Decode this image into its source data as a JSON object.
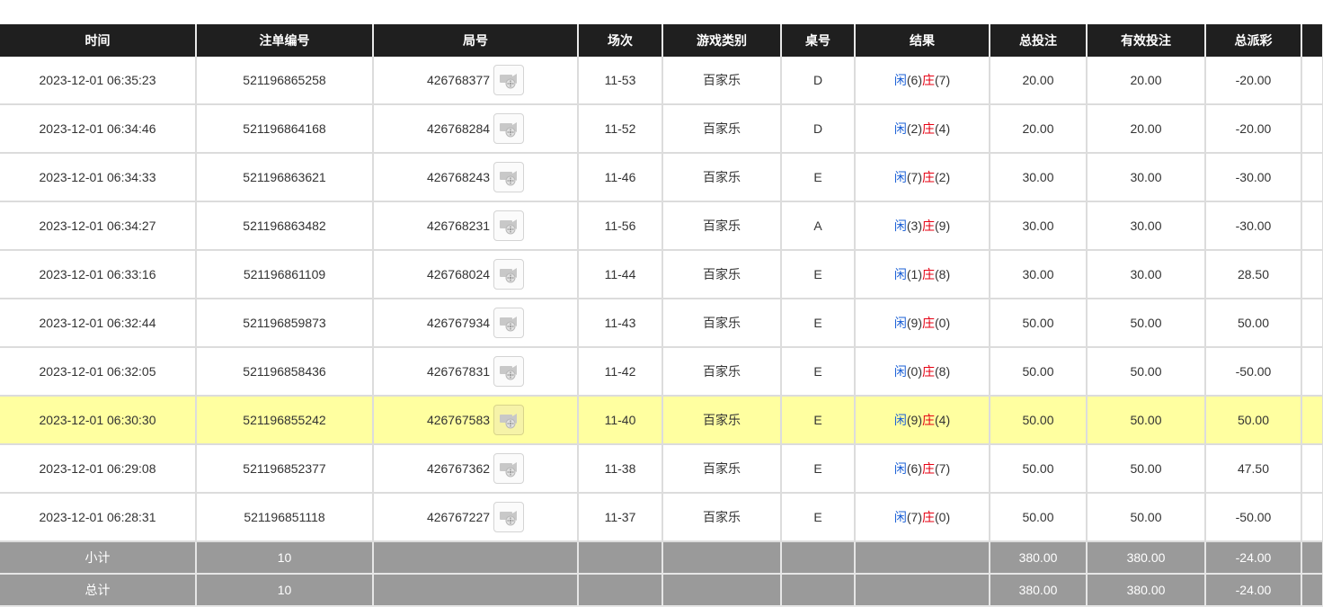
{
  "headers": [
    "时间",
    "注单编号",
    "局号",
    "场次",
    "游戏类别",
    "桌号",
    "结果",
    "总投注",
    "有效投注",
    "总派彩"
  ],
  "colors": {
    "blue": "#1a5fd6",
    "red": "#e60012",
    "highlight": "#ffffa0",
    "header_bg": "#1f1f1f",
    "summary_bg": "#9a9a9a"
  },
  "rows": [
    {
      "time": "2023-12-01 06:35:23",
      "bet_id": "521196865258",
      "round": "426768377",
      "game_no": "11-53",
      "game": "百家乐",
      "table": "D",
      "p_label": "闲",
      "p_val": "(6)",
      "b_label": "庄",
      "b_val": "(7)",
      "total_bet": "20.00",
      "valid_bet": "20.00",
      "payout": "-20.00",
      "payout_negative": true,
      "highlight": false
    },
    {
      "time": "2023-12-01 06:34:46",
      "bet_id": "521196864168",
      "round": "426768284",
      "game_no": "11-52",
      "game": "百家乐",
      "table": "D",
      "p_label": "闲",
      "p_val": "(2)",
      "b_label": "庄",
      "b_val": "(4)",
      "total_bet": "20.00",
      "valid_bet": "20.00",
      "payout": "-20.00",
      "payout_negative": true,
      "highlight": false
    },
    {
      "time": "2023-12-01 06:34:33",
      "bet_id": "521196863621",
      "round": "426768243",
      "game_no": "11-46",
      "game": "百家乐",
      "table": "E",
      "p_label": "闲",
      "p_val": "(7)",
      "b_label": "庄",
      "b_val": "(2)",
      "total_bet": "30.00",
      "valid_bet": "30.00",
      "payout": "-30.00",
      "payout_negative": true,
      "highlight": false
    },
    {
      "time": "2023-12-01 06:34:27",
      "bet_id": "521196863482",
      "round": "426768231",
      "game_no": "11-56",
      "game": "百家乐",
      "table": "A",
      "p_label": "闲",
      "p_val": "(3)",
      "b_label": "庄",
      "b_val": "(9)",
      "total_bet": "30.00",
      "valid_bet": "30.00",
      "payout": "-30.00",
      "payout_negative": true,
      "highlight": false
    },
    {
      "time": "2023-12-01 06:33:16",
      "bet_id": "521196861109",
      "round": "426768024",
      "game_no": "11-44",
      "game": "百家乐",
      "table": "E",
      "p_label": "闲",
      "p_val": "(1)",
      "b_label": "庄",
      "b_val": "(8)",
      "total_bet": "30.00",
      "valid_bet": "30.00",
      "payout": "28.50",
      "payout_negative": false,
      "highlight": false
    },
    {
      "time": "2023-12-01 06:32:44",
      "bet_id": "521196859873",
      "round": "426767934",
      "game_no": "11-43",
      "game": "百家乐",
      "table": "E",
      "p_label": "闲",
      "p_val": "(9)",
      "b_label": "庄",
      "b_val": "(0)",
      "total_bet": "50.00",
      "valid_bet": "50.00",
      "payout": "50.00",
      "payout_negative": false,
      "highlight": false
    },
    {
      "time": "2023-12-01 06:32:05",
      "bet_id": "521196858436",
      "round": "426767831",
      "game_no": "11-42",
      "game": "百家乐",
      "table": "E",
      "p_label": "闲",
      "p_val": "(0)",
      "b_label": "庄",
      "b_val": "(8)",
      "total_bet": "50.00",
      "valid_bet": "50.00",
      "payout": "-50.00",
      "payout_negative": true,
      "highlight": false
    },
    {
      "time": "2023-12-01 06:30:30",
      "bet_id": "521196855242",
      "round": "426767583",
      "game_no": "11-40",
      "game": "百家乐",
      "table": "E",
      "p_label": "闲",
      "p_val": "(9)",
      "b_label": "庄",
      "b_val": "(4)",
      "total_bet": "50.00",
      "valid_bet": "50.00",
      "payout": "50.00",
      "payout_negative": false,
      "highlight": true
    },
    {
      "time": "2023-12-01 06:29:08",
      "bet_id": "521196852377",
      "round": "426767362",
      "game_no": "11-38",
      "game": "百家乐",
      "table": "E",
      "p_label": "闲",
      "p_val": "(6)",
      "b_label": "庄",
      "b_val": "(7)",
      "total_bet": "50.00",
      "valid_bet": "50.00",
      "payout": "47.50",
      "payout_negative": false,
      "highlight": false
    },
    {
      "time": "2023-12-01 06:28:31",
      "bet_id": "521196851118",
      "round": "426767227",
      "game_no": "11-37",
      "game": "百家乐",
      "table": "E",
      "p_label": "闲",
      "p_val": "(7)",
      "b_label": "庄",
      "b_val": "(0)",
      "total_bet": "50.00",
      "valid_bet": "50.00",
      "payout": "-50.00",
      "payout_negative": true,
      "highlight": false
    }
  ],
  "subtotal": {
    "label": "小计",
    "count": "10",
    "total_bet": "380.00",
    "valid_bet": "380.00",
    "payout": "-24.00"
  },
  "total": {
    "label": "总计",
    "count": "10",
    "total_bet": "380.00",
    "valid_bet": "380.00",
    "payout": "-24.00"
  },
  "icons": {
    "video": "video-replay-icon"
  }
}
